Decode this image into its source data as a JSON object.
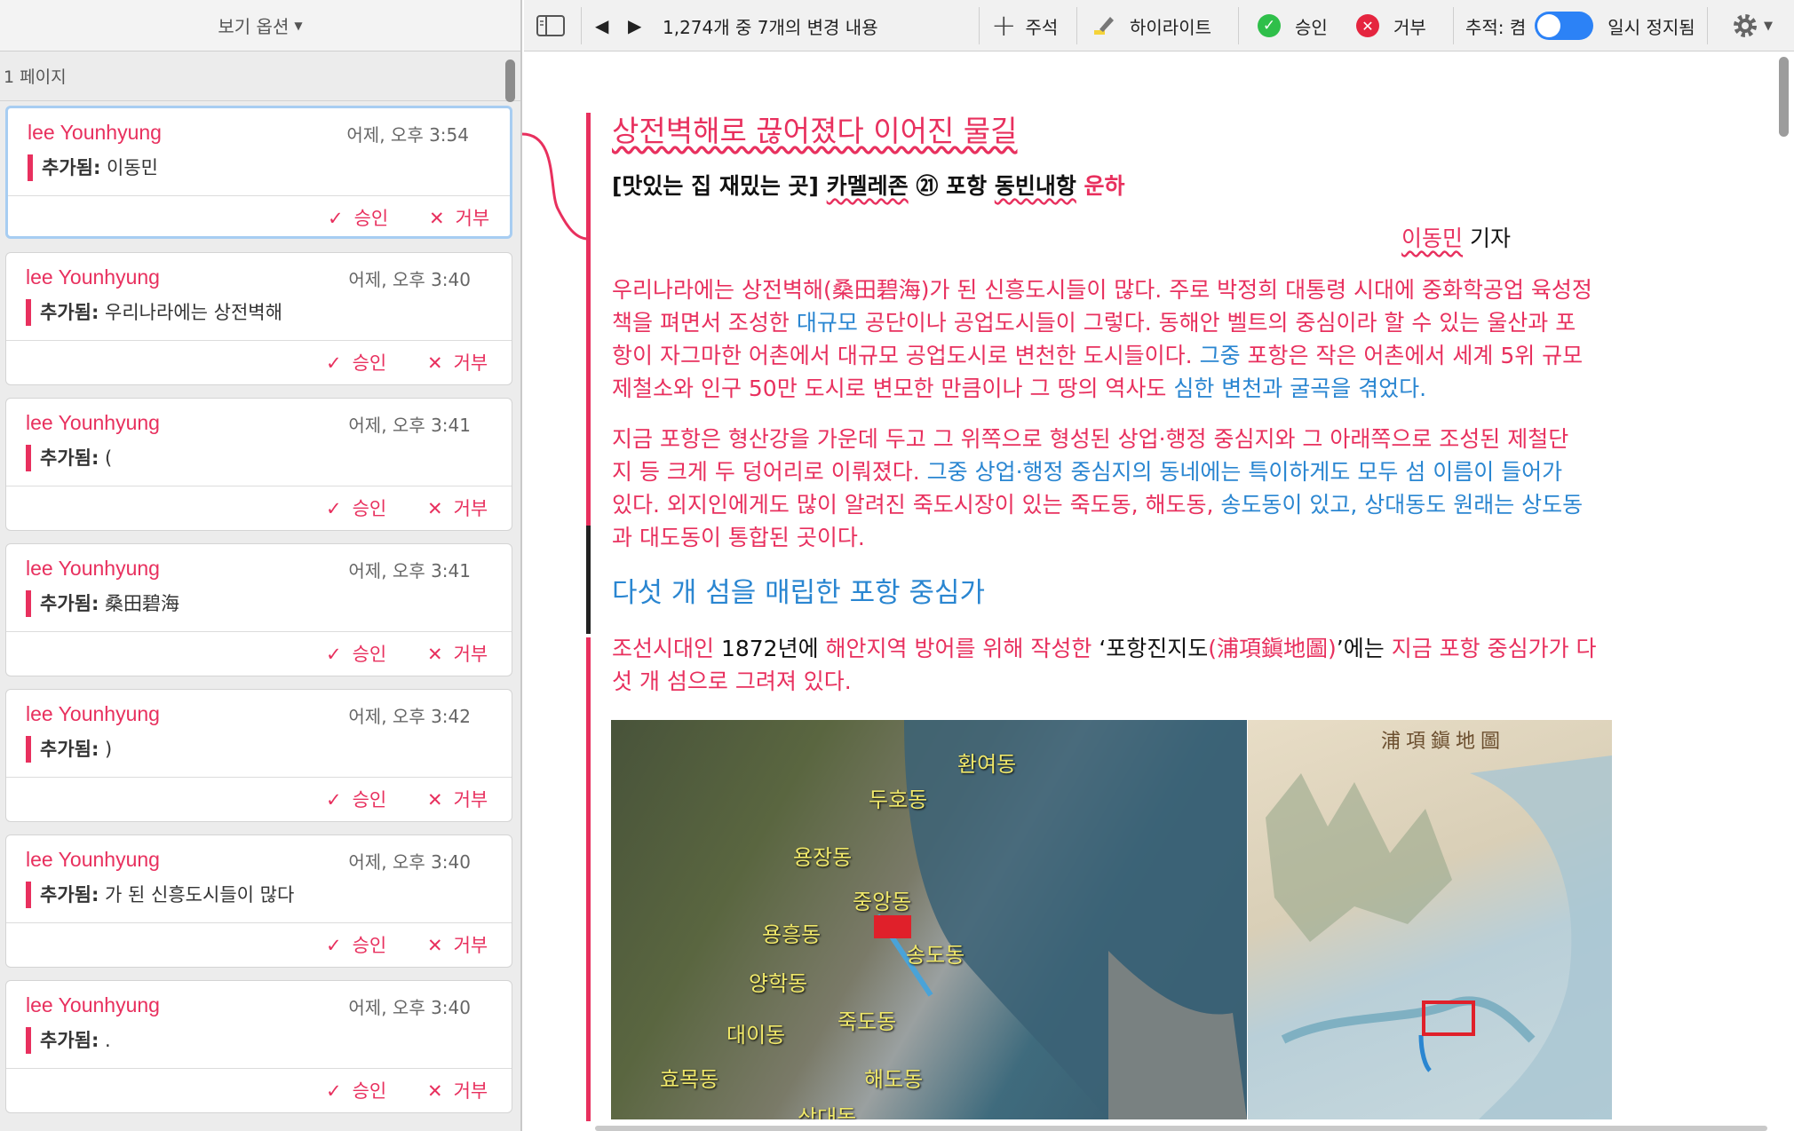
{
  "sidebar": {
    "header": "보기 옵션",
    "page_label": "1 페이지",
    "approve_label": "승인",
    "reject_label": "거부",
    "added_label": "추가됨:",
    "cards": [
      {
        "author": "lee Younhyung",
        "time": "어제, 오후 3:54",
        "text": "이동민"
      },
      {
        "author": "lee Younhyung",
        "time": "어제, 오후 3:40",
        "text": "우리나라에는 상전벽해"
      },
      {
        "author": "lee Younhyung",
        "time": "어제, 오후 3:41",
        "text": "("
      },
      {
        "author": "lee Younhyung",
        "time": "어제, 오후 3:41",
        "text": "桑田碧海"
      },
      {
        "author": "lee Younhyung",
        "time": "어제, 오후 3:42",
        "text": ")"
      },
      {
        "author": "lee Younhyung",
        "time": "어제, 오후 3:40",
        "text": "가 된 신흥도시들이 많다"
      },
      {
        "author": "lee Younhyung",
        "time": "어제, 오후 3:40",
        "text": "."
      }
    ]
  },
  "toolbar": {
    "change_count": "1,274개 중 7개의 변경 내용",
    "comment": "주석",
    "highlight": "하이라이트",
    "approve": "승인",
    "reject": "거부",
    "tracking": "추적: 켬",
    "paused": "일시 정지됨"
  },
  "doc": {
    "title": "상전벽해로 끊어졌다 이어진 물길",
    "subtitle_a": "[맛있는 집 재밌는 곳] ",
    "subtitle_b": "카멜레존",
    "subtitle_c": " ㉑ 포항 ",
    "subtitle_d": "동빈내항",
    "subtitle_e": " 운하",
    "byline_name": "이동민",
    "byline_role": " 기자",
    "p1_line1": "우리나라에는 상전벽해(桑田碧海)가 된 신흥도시들이 많다. 주로 박정희 대통령 시대에 중화학공업 육성정",
    "p1_line2a": "책을 펴면서 조성한 ",
    "p1_line2b": "대규모",
    "p1_line2c": " 공단이나 공업도시들이 그렇다. 동해안 벨트의 중심이라 할 수 있는 울산과 포",
    "p1_line3a": "항이 자그마한 어촌에서 대규모 공업도시로 변천한 도시들이다. ",
    "p1_line3b": "그중",
    "p1_line3c": " 포항은 작은 어촌에서 세계 5위 규모",
    "p1_line4a": "제철소와 인구 50만 도시로 변모한 만큼이나 그 땅의 역사도 ",
    "p1_line4b": "심한 변천과 굴곡을 겪었다.",
    "p2_line1": "지금 포항은 형산강을 가운데 두고 그 위쪽으로 형성된 상업·행정 중심지와 그 아래쪽으로 조성된 제철단",
    "p2_line2a": "지 등 크게 두 덩어리로 이뤄졌다. ",
    "p2_line2b": "그중 상업·행정 중심지의 동네에는 특이하게도 모두 섬 이름이 들어가",
    "p2_line3a": "있다. 외지인에게도 많이 알려진 죽도시장이 있는 죽도동, 해도동, ",
    "p2_line3b": "송도동이 있고, 상대동도 원래는 상도동",
    "p2_line4": "과 대도동이 통합된 곳이다.",
    "heading2": "다섯 개 섬을 매립한 포항 중심가",
    "p3_line1a": "조선시대인 ",
    "p3_line1b": "1872년에",
    "p3_line1c": " 해안지역 방어를 위해 작성한 ",
    "p3_line1d": "‘포항진지도",
    "p3_line1e": "(浦項鎭地圖)",
    "p3_line1f": "’에는",
    "p3_line1g": " 지금 포항 중심가가 다",
    "p3_line2": "섯 개 섬으로 그려져 있다."
  },
  "map_labels": [
    "환여동",
    "두호동",
    "용장동",
    "중앙동",
    "송도동",
    "용흥동",
    "양학동",
    "대이동",
    "죽도동",
    "효목동",
    "해도동",
    "상대동"
  ],
  "map_right_title": "浦項鎭地圖",
  "colors": {
    "insert": "#e8305e",
    "move": "#2a86d1",
    "selected_border": "#a7cdf2",
    "toggle": "#2c82f6"
  }
}
